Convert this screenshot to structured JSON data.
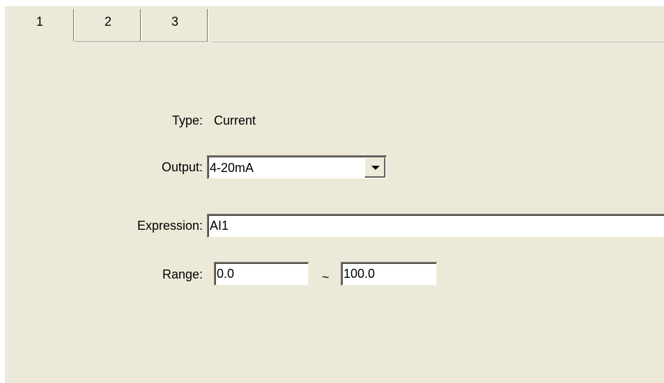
{
  "tabs": [
    {
      "label": "1",
      "active": true
    },
    {
      "label": "2",
      "active": false
    },
    {
      "label": "3",
      "active": false
    }
  ],
  "form": {
    "type_label": "Type:",
    "type_value": "Current",
    "output_label": "Output:",
    "output_value": "4-20mA",
    "expression_label": "Expression:",
    "expression_value": "AI1",
    "range_label": "Range:",
    "range_min": "0.0",
    "range_separator": "~",
    "range_max": "100.0"
  },
  "icons": {
    "dropdown": "chevron-down-icon"
  },
  "colors": {
    "panel_background": "#ece9d8",
    "field_background": "#ffffff"
  }
}
